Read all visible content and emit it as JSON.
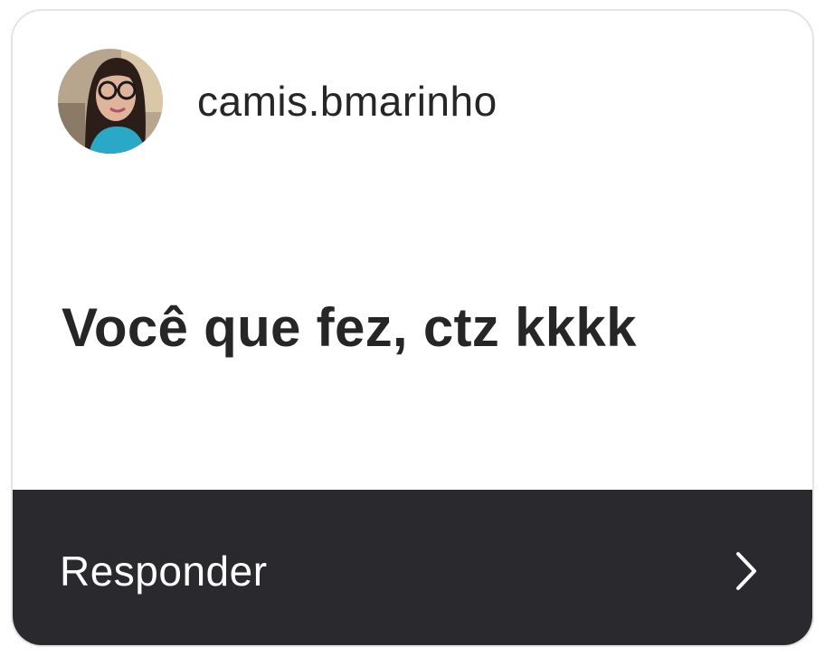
{
  "comment": {
    "username": "camis.bmarinho",
    "avatar_icon": "profile-photo",
    "text": "Você que fez, ctz kkkk"
  },
  "reply": {
    "label": "Responder",
    "icon": "chevron-right-icon"
  },
  "colors": {
    "card_bg": "#ffffff",
    "card_border": "#e4e4e6",
    "text": "#262626",
    "reply_bg": "#2a2a2e",
    "reply_text": "#ffffff"
  }
}
